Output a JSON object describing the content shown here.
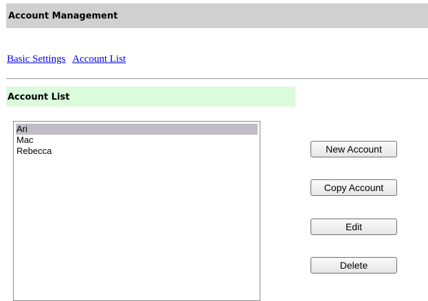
{
  "header": {
    "title": "Account Management"
  },
  "nav": {
    "links": [
      {
        "label": "Basic Settings"
      },
      {
        "label": "Account List"
      }
    ]
  },
  "section": {
    "title": "Account List"
  },
  "accounts": {
    "items": [
      {
        "label": "Ari",
        "selected": true
      },
      {
        "label": "Mac",
        "selected": false
      },
      {
        "label": "Rebecca",
        "selected": false
      }
    ]
  },
  "actions": {
    "new_label": "New Account",
    "copy_label": "Copy Account",
    "edit_label": "Edit",
    "delete_label": "Delete"
  },
  "colors": {
    "title_bar_bg": "#d0d0d0",
    "section_head_bg": "#dcfadc",
    "link": "#0000ee",
    "selected_item_bg": "#c0bcc4"
  }
}
